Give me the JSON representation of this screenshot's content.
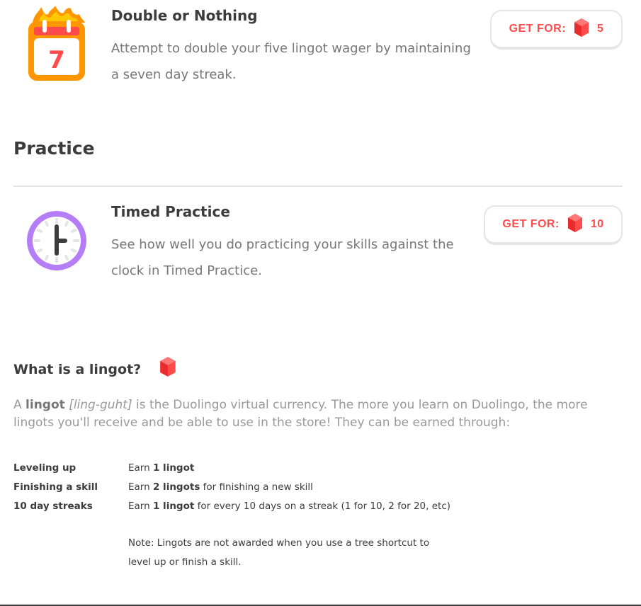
{
  "items": [
    {
      "title": "Double or Nothing",
      "description": "Attempt to double your five lingot wager by maintaining a seven day streak.",
      "icon": "calendar-icon",
      "calendar_day": "7",
      "button": {
        "label": "GET FOR:",
        "price": "5"
      }
    },
    {
      "title": "Timed Practice",
      "description": "See how well you do practicing your skills against the clock in Timed Practice.",
      "icon": "clock-icon",
      "button": {
        "label": "GET FOR:",
        "price": "10"
      }
    }
  ],
  "section": {
    "practice_heading": "Practice"
  },
  "lingot_info": {
    "title": "What is a lingot?",
    "body_prefix": "A ",
    "body_word": "lingot",
    "body_pron": "[ling-guht]",
    "body_rest": " is the Duolingo virtual currency. The more you learn on Duolingo, the more lingots you'll receive and be able to use in the store! They can be earned through:",
    "rows": [
      {
        "key": "Leveling up",
        "pre": "Earn ",
        "bold": "1 lingot",
        "post": ""
      },
      {
        "key": "Finishing a skill",
        "pre": "Earn ",
        "bold": "2 lingots",
        "post": " for finishing a new skill"
      },
      {
        "key": "10 day streaks",
        "pre": "Earn ",
        "bold": "1 lingot",
        "post": " for every 10 days on a streak (1 for 10, 2 for 20, etc)"
      }
    ],
    "note": "Note: Lingots are not awarded when you use a tree shortcut to level up or finish a skill."
  },
  "colors": {
    "accent_red": "#ff4b4b",
    "clock_purple": "#b57ef6",
    "calendar_orange": "#ff9600"
  }
}
